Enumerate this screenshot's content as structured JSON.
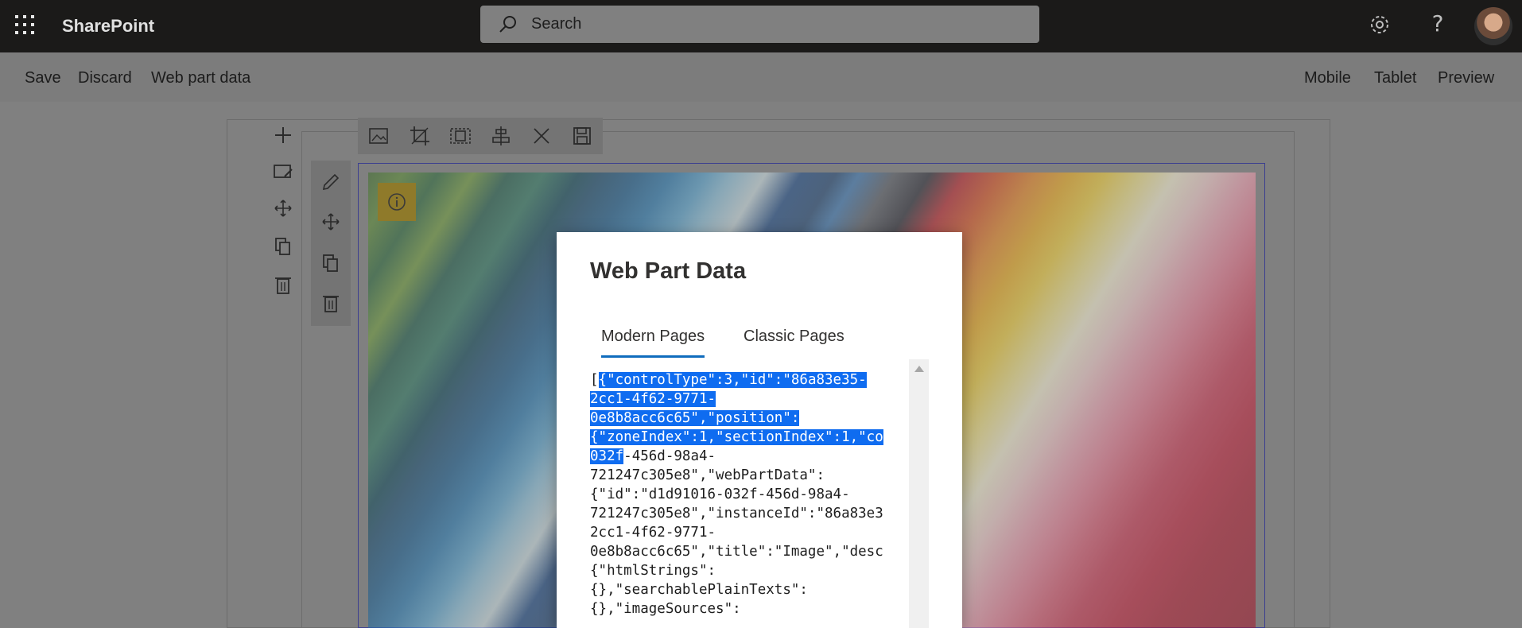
{
  "suite_bar": {
    "app_name": "SharePoint",
    "search_placeholder": "Search",
    "help_glyph": "?",
    "icons": [
      "waffle-icon",
      "search-icon",
      "gear-icon",
      "help-icon",
      "avatar"
    ]
  },
  "command_bar": {
    "left": [
      "Save",
      "Discard",
      "Web part data"
    ],
    "right": [
      "Mobile",
      "Tablet",
      "Preview"
    ]
  },
  "section_tools": [
    "add-section-icon",
    "edit-section-icon",
    "move-icon",
    "duplicate-icon",
    "delete-icon"
  ],
  "webpart_tools": [
    "edit-pencil-icon",
    "move-icon",
    "duplicate-icon",
    "delete-icon"
  ],
  "image_toolbar": [
    "image-reset-icon",
    "crop-icon",
    "aspect-ratio-icon",
    "align-icon",
    "close-icon",
    "save-icon"
  ],
  "dialog": {
    "title": "Web Part Data",
    "tabs": [
      {
        "label": "Modern Pages",
        "active": true
      },
      {
        "label": "Classic Pages",
        "active": false
      }
    ],
    "code_lines": [
      {
        "pre": "[",
        "sel": "{\"controlType\":3,\"id\":\"86a83e35-",
        "post": ""
      },
      {
        "pre": "",
        "sel": "2cc1-4f62-9771-",
        "post": ""
      },
      {
        "pre": "",
        "sel": "0e8b8acc6c65\",\"position\":",
        "post": ""
      },
      {
        "pre": "",
        "sel": "{\"zoneIndex\":1,\"sectionIndex\":1,\"co",
        "post": ""
      },
      {
        "pre": "",
        "sel": "032f",
        "post": "-456d-98a4-"
      },
      {
        "pre": "",
        "sel": "",
        "post": "721247c305e8\",\"webPartData\":"
      },
      {
        "pre": "",
        "sel": "",
        "post": "{\"id\":\"d1d91016-032f-456d-98a4-"
      },
      {
        "pre": "",
        "sel": "",
        "post": "721247c305e8\",\"instanceId\":\"86a83e3"
      },
      {
        "pre": "",
        "sel": "",
        "post": "2cc1-4f62-9771-"
      },
      {
        "pre": "",
        "sel": "",
        "post": "0e8b8acc6c65\",\"title\":\"Image\",\"desc"
      },
      {
        "pre": "",
        "sel": "",
        "post": "{\"htmlStrings\":"
      },
      {
        "pre": "",
        "sel": "",
        "post": "{},\"searchablePlainTexts\":"
      },
      {
        "pre": "",
        "sel": "",
        "post": "{},\"imageSources\":"
      }
    ]
  },
  "colors": {
    "suite_bar": "#1b1a19",
    "accent": "#0f6cbd",
    "selection": "#0f6cf0",
    "info_button": "#8f7a2a"
  }
}
